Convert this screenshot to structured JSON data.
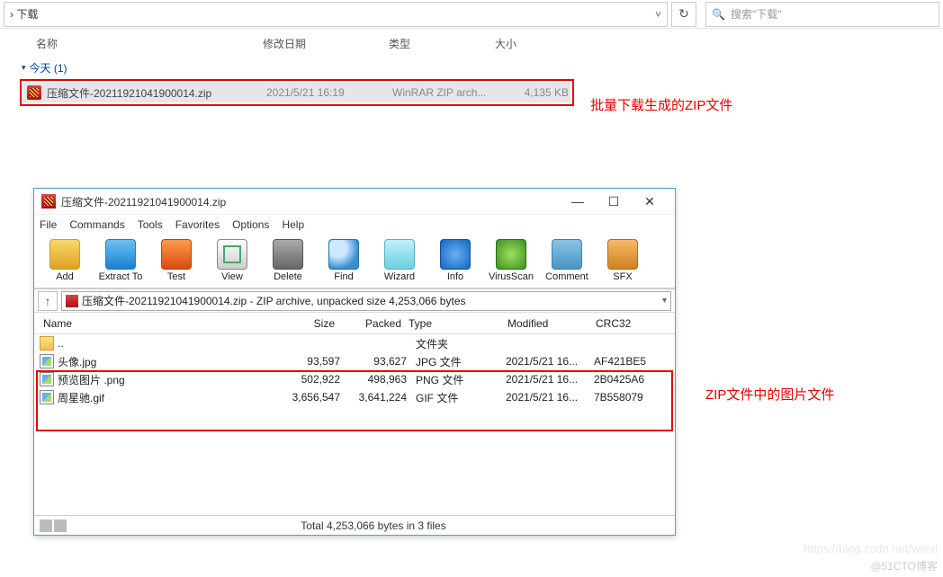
{
  "explorer": {
    "breadcrumb": "下载",
    "search_placeholder": "搜索\"下载\"",
    "columns": {
      "name": "名称",
      "modified": "修改日期",
      "type": "类型",
      "size": "大小"
    },
    "group": "今天 (1)",
    "file": {
      "name": "压缩文件-20211921041900014.zip",
      "modified": "2021/5/21 16:19",
      "type": "WinRAR ZIP arch...",
      "size": "4,135 KB"
    }
  },
  "annotations": {
    "top": "批量下载生成的ZIP文件",
    "mid": "ZIP文件中的图片文件"
  },
  "winrar": {
    "title": "压缩文件-20211921041900014.zip",
    "menu": [
      "File",
      "Commands",
      "Tools",
      "Favorites",
      "Options",
      "Help"
    ],
    "tools": [
      {
        "label": "Add",
        "cls": "i-add"
      },
      {
        "label": "Extract To",
        "cls": "i-ext"
      },
      {
        "label": "Test",
        "cls": "i-test"
      },
      {
        "label": "View",
        "cls": "i-view"
      },
      {
        "label": "Delete",
        "cls": "i-del"
      },
      {
        "label": "Find",
        "cls": "i-find"
      },
      {
        "label": "Wizard",
        "cls": "i-wiz"
      },
      {
        "label": "Info",
        "cls": "i-info"
      },
      {
        "label": "VirusScan",
        "cls": "i-virus"
      },
      {
        "label": "Comment",
        "cls": "i-comm"
      },
      {
        "label": "SFX",
        "cls": "i-sfx"
      }
    ],
    "path": "压缩文件-20211921041900014.zip - ZIP archive, unpacked size 4,253,066 bytes",
    "cols": {
      "name": "Name",
      "size": "Size",
      "packed": "Packed",
      "type": "Type",
      "modified": "Modified",
      "crc": "CRC32"
    },
    "rows": [
      {
        "name": "..",
        "size": "",
        "packed": "",
        "type": "文件夹",
        "modified": "",
        "crc": "",
        "icon": "folder"
      },
      {
        "name": "头像.jpg",
        "size": "93,597",
        "packed": "93,627",
        "type": "JPG 文件",
        "modified": "2021/5/21 16...",
        "crc": "AF421BE5",
        "icon": "img"
      },
      {
        "name": "预览图片 .png",
        "size": "502,922",
        "packed": "498,963",
        "type": "PNG 文件",
        "modified": "2021/5/21 16...",
        "crc": "2B0425A6",
        "icon": "img"
      },
      {
        "name": "周星驰.gif",
        "size": "3,656,547",
        "packed": "3,641,224",
        "type": "GIF 文件",
        "modified": "2021/5/21 16...",
        "crc": "7B558079",
        "icon": "img"
      }
    ],
    "status": "Total 4,253,066 bytes in 3 files"
  },
  "watermark": "@51CTO博客",
  "bg_text": "https://blog.csdn.net/weixi"
}
